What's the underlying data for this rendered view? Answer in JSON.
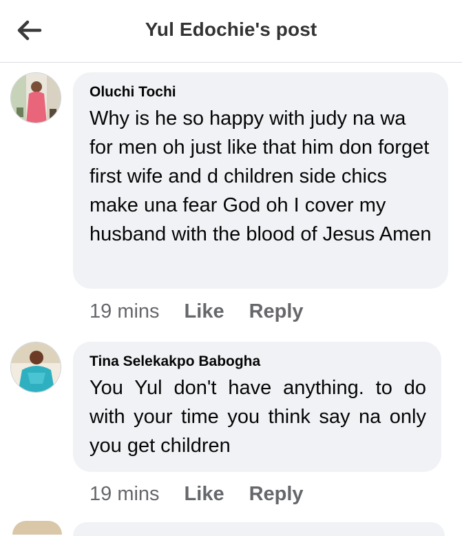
{
  "header": {
    "title": "Yul Edochie's post",
    "back_icon": "arrow-left-icon"
  },
  "comments": [
    {
      "author": "Oluchi Tochi",
      "text": "Why is he so happy with judy na wa for men oh just like that him don forget first wife and d children side chics make una fear God oh I cover my husband with the blood of Jesus Amen",
      "time": "19 mins",
      "like_label": "Like",
      "reply_label": "Reply",
      "avatar_colors": [
        "#e8657a",
        "#b8c9a0",
        "#f4f0e6"
      ]
    },
    {
      "author": "Tina Selekakpo Babogha",
      "text": "You Yul don't have anything. to do with your time you think say na only you get children",
      "time": "19 mins",
      "like_label": "Like",
      "reply_label": "Reply",
      "avatar_colors": [
        "#2fb0c0",
        "#d7c9a9",
        "#6b3b26"
      ]
    }
  ],
  "colors": {
    "bubble_bg": "#f0f2f5",
    "meta_text": "#65676b",
    "divider": "#dadde1"
  }
}
